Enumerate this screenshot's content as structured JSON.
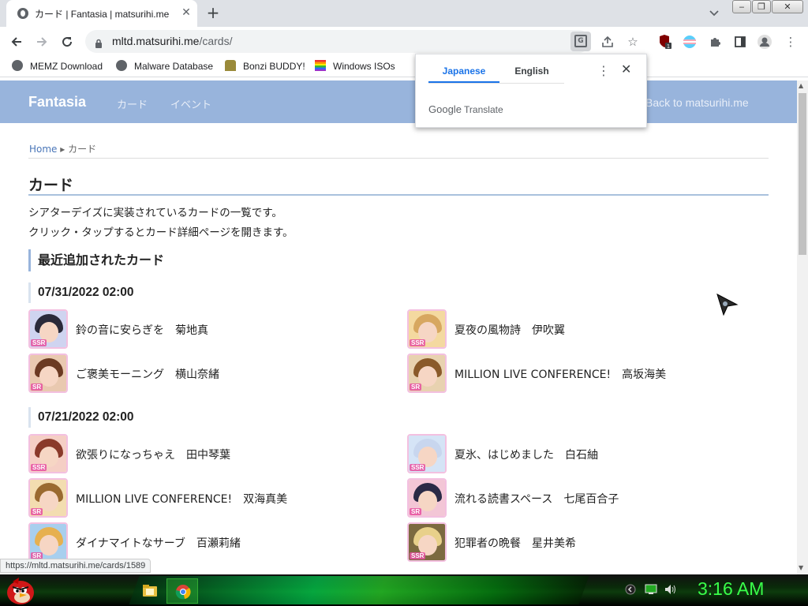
{
  "browser": {
    "tab_title": "カード | Fantasia | matsurihi.me",
    "tab_close": "✕",
    "new_tab": "+",
    "url_host": "mltd.matsurihi.me",
    "url_path": "/cards/",
    "window_buttons": [
      "‒",
      "❐",
      "✕"
    ],
    "bookmarks": [
      {
        "label": "MEMZ Download",
        "icon": "globe-icon",
        "color": "#5f6368"
      },
      {
        "label": "Malware Database",
        "icon": "globe-icon",
        "color": "#5f6368"
      },
      {
        "label": "Bonzi BUDDY!",
        "icon": "bonzi-icon",
        "color": "#7a6a2a"
      },
      {
        "label": "Windows ISOs",
        "icon": "windows-icon",
        "color": "#e04040"
      }
    ],
    "status_url": "https://mltd.matsurihi.me/cards/1589"
  },
  "translate_popup": {
    "tab_source": "Japanese",
    "tab_target": "English",
    "brand": "Google",
    "product": "Translate",
    "menu": "⋮",
    "close": "✕"
  },
  "site": {
    "brand": "Fantasia",
    "nav": [
      "カード",
      "イベント"
    ],
    "back_link": "Back to matsurihi.me",
    "breadcrumb_home": "Home",
    "breadcrumb_sep": "▸",
    "breadcrumb_current": "カード",
    "heading": "カード",
    "desc_1": "シアターデイズに実装されているカードの一覧です。",
    "desc_2": "クリック・タップするとカード詳細ページを開きます。",
    "section_title": "最近追加されたカード",
    "groups": [
      {
        "date": "07/31/2022 02:00",
        "cards": [
          {
            "title": "鈴の音に安らぎを　菊地真",
            "rarity": "SSR",
            "bg": "#cfd4f0",
            "hair": "#2a2a3a"
          },
          {
            "title": "夏夜の風物詩　伊吹翼",
            "rarity": "SSR",
            "bg": "#f4d9a0",
            "hair": "#d7a760"
          },
          {
            "title": "ご褒美モーニング　横山奈緒",
            "rarity": "SR",
            "bg": "#e9c9b0",
            "hair": "#6b3a22"
          },
          {
            "title": "MILLION LIVE CONFERENCE!　高坂海美",
            "rarity": "SR",
            "bg": "#e8d2b0",
            "hair": "#8a5a2a"
          }
        ]
      },
      {
        "date": "07/21/2022 02:00",
        "cards": [
          {
            "title": "欲張りになっちゃえ　田中琴葉",
            "rarity": "SSR",
            "bg": "#f5cfc5",
            "hair": "#8a3a2a"
          },
          {
            "title": "夏氷、はじめました　白石紬",
            "rarity": "SSR",
            "bg": "#d5e4f6",
            "hair": "#c8d6ee"
          },
          {
            "title": "MILLION LIVE CONFERENCE!　双海真美",
            "rarity": "SR",
            "bg": "#f3ddb0",
            "hair": "#9a6a30"
          },
          {
            "title": "流れる読書スペース　七尾百合子",
            "rarity": "SR",
            "bg": "#f3c6d6",
            "hair": "#2a2a46"
          },
          {
            "title": "ダイナマイトなサーブ　百瀬莉緒",
            "rarity": "SR",
            "bg": "#a8cfee",
            "hair": "#e6b050"
          },
          {
            "title": "犯罪者の晩餐　星井美希",
            "rarity": "SSR",
            "bg": "#7c6a40",
            "hair": "#e8d08a"
          }
        ]
      }
    ]
  },
  "taskbar": {
    "clock": "3:16 AM",
    "colors": {
      "clock": "#39ff4a"
    }
  }
}
